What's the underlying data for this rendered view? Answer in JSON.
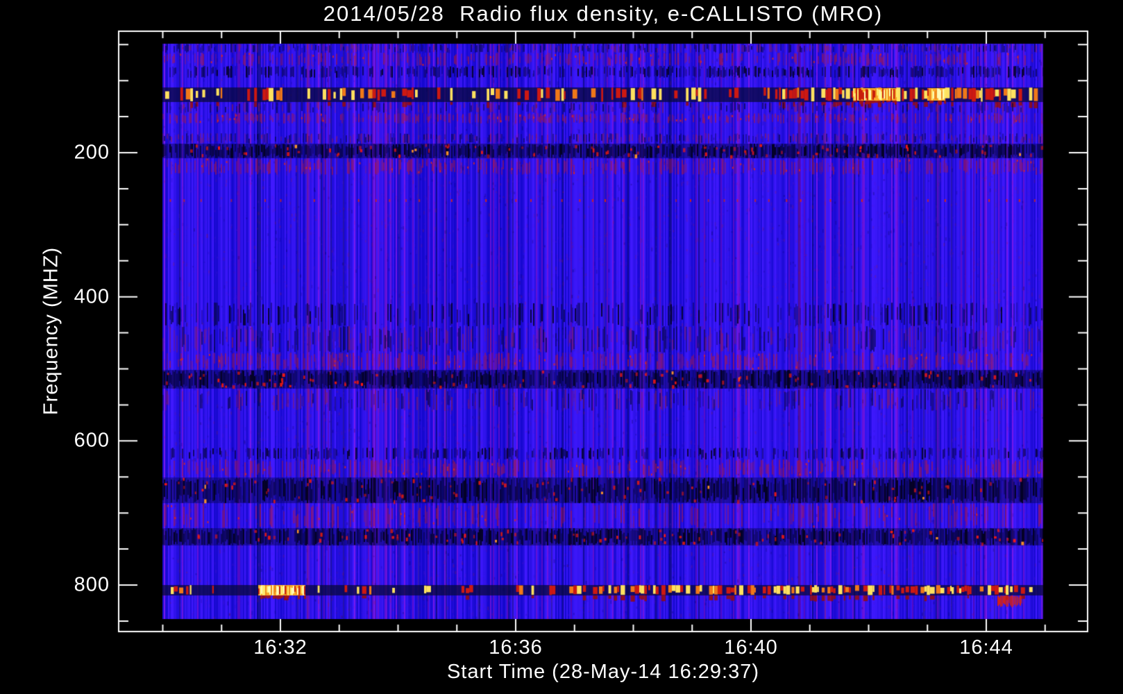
{
  "title": "2014/05/28  Radio flux density, e-CALLISTO (MRO)",
  "chart_data": {
    "type": "heatmap",
    "subtype": "radio-spectrogram",
    "title": "2014/05/28  Radio flux density, e-CALLISTO (MRO)",
    "xlabel": "Start Time (28-May-14 16:29:37)",
    "ylabel": "Frequency (MHZ)",
    "date": "2014/05/28",
    "start_time": "16:29:37",
    "instrument": "e-CALLISTO (MRO)",
    "x_axis": {
      "ticks_major": [
        {
          "label": "16:32",
          "t_min": 0
        },
        {
          "label": "16:36",
          "t_min": 4
        },
        {
          "label": "16:40",
          "t_min": 8
        },
        {
          "label": "16:44",
          "t_min": 12
        }
      ],
      "minor_step_min": 1,
      "range_min": [
        -2.75,
        13.72
      ]
    },
    "y_axis": {
      "unit": "MHZ",
      "ticks_major": [
        200,
        400,
        600,
        800
      ],
      "minor_step": 50,
      "range_mhz": [
        31,
        864
      ],
      "direction": "inverted"
    },
    "data_extent": {
      "t_min": [
        -2.0,
        12.97
      ],
      "freq_mhz": [
        49,
        847
      ]
    },
    "grid": false,
    "legend": "none",
    "palette": {
      "background": "#000000",
      "frame": "#ffffff",
      "text": "#ffffff",
      "base_blue": "#2012e6",
      "purple_noise": "#5a1ed2",
      "dark_navy": "#0a0560",
      "near_black": "#020225",
      "red": "#cc1c1c",
      "bright_red": "#ee3214",
      "orange": "#f07b20",
      "yellow": "#ffe15e",
      "pale_yellow": "#fff8b0"
    },
    "bands": [
      {
        "f0": 49,
        "f1": 61,
        "kind": "striation-mixed",
        "density": 0.55
      },
      {
        "f0": 61,
        "f1": 80,
        "kind": "striation-red",
        "density": 0.35
      },
      {
        "f0": 80,
        "f1": 96,
        "kind": "striation-dark",
        "density": 0.55
      },
      {
        "f0": 109,
        "f1": 130,
        "kind": "rfi-line",
        "base_density": 0.2,
        "clusters": [
          {
            "t0": 8.4,
            "t1": 12.6,
            "density": 0.5
          }
        ],
        "note": "VHF RFI ~120 MHz"
      },
      {
        "f0": 130,
        "f1": 145,
        "kind": "striation-mixed",
        "density": 0.3
      },
      {
        "f0": 145,
        "f1": 160,
        "kind": "striation-red",
        "density": 0.45
      },
      {
        "f0": 173,
        "f1": 187,
        "kind": "striation-mixed",
        "density": 0.5
      },
      {
        "f0": 187,
        "f1": 208,
        "kind": "band-dark-speckle",
        "density": 0.8,
        "note": "RFI ~200 MHz"
      },
      {
        "f0": 208,
        "f1": 231,
        "kind": "striation-red",
        "density": 0.4
      },
      {
        "f0": 265,
        "f1": 270,
        "kind": "dot-line",
        "spacing_px": 21
      },
      {
        "f0": 408,
        "f1": 441,
        "kind": "striation-dark",
        "density": 0.35
      },
      {
        "f0": 441,
        "f1": 477,
        "kind": "striation-mixed",
        "density": 0.4
      },
      {
        "f0": 477,
        "f1": 501,
        "kind": "striation-red",
        "density": 0.45
      },
      {
        "f0": 501,
        "f1": 527,
        "kind": "band-dark-speckle",
        "density": 0.85,
        "note": "RFI ~515 MHz"
      },
      {
        "f0": 527,
        "f1": 558,
        "kind": "striation-mixed",
        "density": 0.35
      },
      {
        "f0": 609,
        "f1": 626,
        "kind": "striation-dark",
        "density": 0.4
      },
      {
        "f0": 626,
        "f1": 651,
        "kind": "striation-red",
        "density": 0.45
      },
      {
        "f0": 651,
        "f1": 686,
        "kind": "band-dark-speckle",
        "density": 0.8,
        "note": "RFI ~670 MHz"
      },
      {
        "f0": 686,
        "f1": 721,
        "kind": "striation-red",
        "density": 0.25
      },
      {
        "f0": 721,
        "f1": 745,
        "kind": "band-dark-speckle",
        "density": 0.8,
        "note": "RFI ~735 MHz"
      },
      {
        "f0": 800,
        "f1": 814,
        "kind": "rfi-line",
        "base_density": 0.13,
        "clusters": [
          {
            "t0": 4.9,
            "t1": 12.5,
            "density": 0.5
          }
        ],
        "note": "RFI ~807 MHz"
      }
    ],
    "features": [
      {
        "kind": "yellow-blob",
        "f0": 800,
        "f1": 814,
        "t0": -0.38,
        "t1": 0.43
      },
      {
        "kind": "yellow-blob",
        "f0": 110,
        "f1": 128,
        "t0": 9.74,
        "t1": 10.48
      },
      {
        "kind": "yellow-blob",
        "f0": 110,
        "f1": 128,
        "t0": 11.0,
        "t1": 11.3
      },
      {
        "kind": "red-patch",
        "f0": 814,
        "f1": 831,
        "t0": 12.19,
        "t1": 12.61
      }
    ]
  }
}
